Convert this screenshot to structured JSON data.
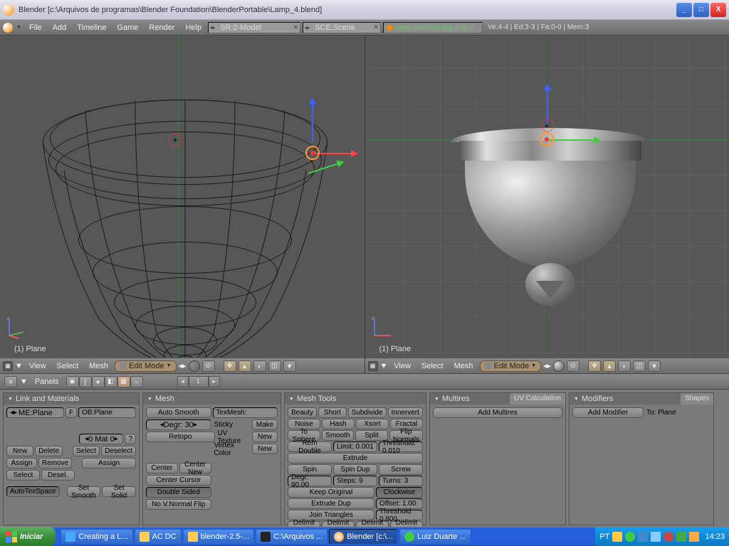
{
  "titlebar": {
    "text": "Blender [c:\\Arquivos de programas\\Blender Foundation\\BlenderPortable\\Lamp_4.blend]"
  },
  "menubar": {
    "file": "File",
    "add": "Add",
    "timeline": "Timeline",
    "game": "Game",
    "render": "Render",
    "help": "Help",
    "sr_field": "SR:2-Model",
    "sce_field": "SCE:Scene",
    "url": "www.blender.org 249.2",
    "stats": "Ve:4-4 | Ed:3-3 | Fa:0-0 | Mem:3"
  },
  "viewport_left": {
    "label": "(1) Plane"
  },
  "viewport_right": {
    "label": "(1) Plane"
  },
  "vp_header": {
    "view": "View",
    "select": "Select",
    "mesh": "Mesh",
    "mode": "Edit Mode"
  },
  "panels_header": {
    "title": "Panels",
    "page": "1"
  },
  "links_panel": {
    "title": "Link and Materials",
    "me_label": "ME:Plane",
    "ob_label": "OB:Plane",
    "f": "F",
    "mat": "0 Mat 0",
    "q": "?",
    "new": "New",
    "delete": "Delete",
    "select": "Select",
    "deselect": "Deselect",
    "assign": "Assign",
    "remove": "Remove",
    "desel": "Desel.",
    "select2": "Select",
    "autotex": "AutoTexSpace",
    "setsmooth": "Set Smooth",
    "setsolid": "Set Solid"
  },
  "mesh_panel": {
    "title": "Mesh",
    "autosmooth": "Auto Smooth",
    "degr": "Degr: 30",
    "retopo": "Retopo",
    "center": "Center",
    "centernew": "Center New",
    "centercursor": "Center Cursor",
    "doublesided": "Double Sided",
    "novnormal": "No V.Normal Flip",
    "texmesh": "TexMesh:",
    "sticky": "Sticky",
    "make": "Make",
    "uvtex": "UV Texture",
    "new": "New",
    "vcol": "Vertex Color"
  },
  "mtools_panel": {
    "title": "Mesh Tools",
    "beauty": "Beauty",
    "short": "Short",
    "subdivide": "Subdivide",
    "innervert": "Innervert",
    "noise": "Noise",
    "hash": "Hash",
    "xsort": "Xsort",
    "fractal": "Fractal",
    "tosphere": "To Sphere",
    "smooth": "Smooth",
    "split": "Split",
    "flipnorm": "Flip Normals",
    "remdouble": "Rem Double",
    "limit": "Limit: 0.001",
    "threshold": "Threshold: 0.010",
    "extrude": "Extrude",
    "spin": "Spin",
    "spindup": "Spin Dup",
    "screw": "Screw",
    "degr90": "Degr: 90.00",
    "steps": "Steps: 9",
    "turns": "Turns: 3",
    "keeporig": "Keep Original",
    "clockwise": "Clockwise",
    "extrudedup": "Extrude Dup",
    "offset": "Offset: 1.00",
    "jointri": "Join Triangles",
    "threshold2": "Threshold 0.800",
    "delimituv": "Delimit UVs",
    "delimitvcol": "Delimit Vcol",
    "delimitshar": "Delimit Shar",
    "delimitmat": "Delimit Mat"
  },
  "multi_panel": {
    "title_multi": "Multires",
    "title_uv": "UV Calculation",
    "add_multires": "Add Multires"
  },
  "mods_panel": {
    "title_mod": "Modifiers",
    "title_shapes": "Shapes",
    "add_modifier": "Add Modifier",
    "to": "To: Plane"
  },
  "taskbar": {
    "start": "Iniciar",
    "btn1": "Creating a L...",
    "btn2": "AC DC",
    "btn3": "blender-2.5-...",
    "btn4": "C:\\Arquivos ...",
    "btn5": "Blender [c:\\...",
    "btn6": "Luiz Duarte ...",
    "lang": "PT",
    "clock": "14:23"
  }
}
